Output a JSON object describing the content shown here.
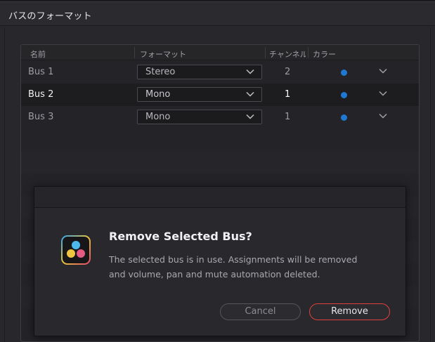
{
  "window": {
    "title": "バスのフォーマット"
  },
  "table": {
    "headers": {
      "name": "名前",
      "format": "フォーマット",
      "channels": "チャンネル",
      "color": "カラー"
    },
    "rows": [
      {
        "name": "Bus 1",
        "format": "Stereo",
        "channels": "2",
        "color": "#1f78d1",
        "selected": false
      },
      {
        "name": "Bus 2",
        "format": "Mono",
        "channels": "1",
        "color": "#1f78d1",
        "selected": true
      },
      {
        "name": "Bus 3",
        "format": "Mono",
        "channels": "1",
        "color": "#1f78d1",
        "selected": false
      }
    ]
  },
  "dialog": {
    "title": "Remove Selected Bus?",
    "message": "The selected bus is in use. Assignments will be removed and volume, pan and mute automation deleted.",
    "cancel_label": "Cancel",
    "remove_label": "Remove",
    "icon": "davinci-resolve-icon"
  },
  "colors": {
    "accent_remove": "#e0403c",
    "bus_dot": "#1f78d1"
  }
}
